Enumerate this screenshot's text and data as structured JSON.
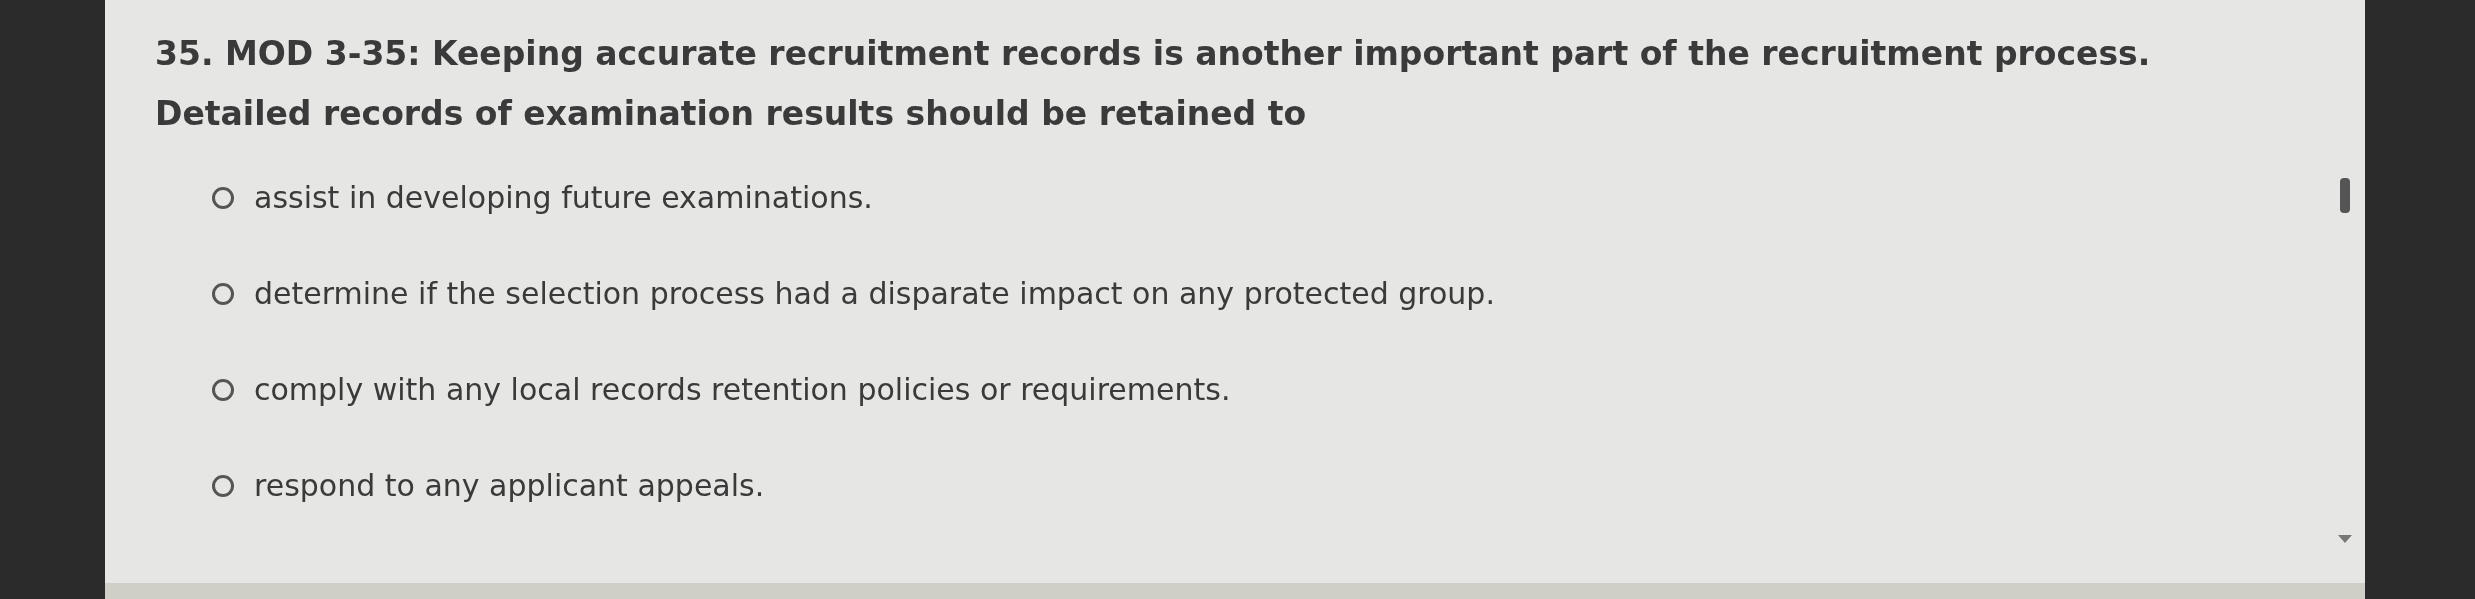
{
  "question": {
    "text": "35. MOD 3-35: Keeping accurate recruitment records is another important part of the recruitment process. Detailed records of examination results should be retained to"
  },
  "options": [
    {
      "label": "assist in developing future examinations.",
      "selected": false
    },
    {
      "label": "determine if the selection process had a disparate impact on any protected group.",
      "selected": false
    },
    {
      "label": "comply with any local records retention policies or requirements.",
      "selected": false
    },
    {
      "label": "respond to any applicant appeals.",
      "selected": false
    }
  ]
}
